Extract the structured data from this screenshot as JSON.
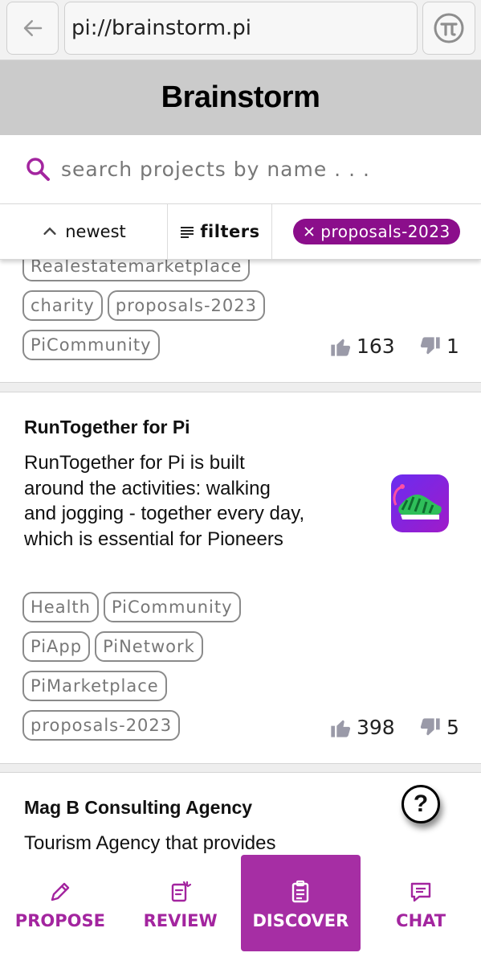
{
  "browser": {
    "url": "pi://brainstorm.pi",
    "back_icon": "arrow-left-icon",
    "pi_icon": "pi-logo-icon"
  },
  "header": {
    "title": "Brainstorm"
  },
  "search": {
    "placeholder": "search projects by name . . ."
  },
  "filters": {
    "sort_label": "newest",
    "filters_label": "filters",
    "active_filter": "proposals-2023"
  },
  "cards": [
    {
      "partial_tag": "Realestatemarketplace",
      "tags_row1": [
        "charity",
        "proposals-2023"
      ],
      "tags_row2": [
        "PiCommunity"
      ],
      "likes": "163",
      "dislikes": "1"
    },
    {
      "title": "RunTogether for Pi",
      "description": "RunTogether for Pi is built around the activities: walking and jogging - together every day, which is essential for Pioneers",
      "image_icon": "sneaker-app-icon",
      "tags": [
        [
          "Health",
          "PiCommunity"
        ],
        [
          "PiApp",
          "PiNetwork"
        ],
        [
          "PiMarketplace"
        ],
        [
          "proposals-2023"
        ]
      ],
      "likes": "398",
      "dislikes": "5"
    },
    {
      "title": "Mag B Consulting Agency",
      "description": "Tourism Agency that provides"
    }
  ],
  "help": {
    "label": "?"
  },
  "bottom_nav": {
    "items": [
      {
        "label": "PROPOSE",
        "icon": "pencil-icon"
      },
      {
        "label": "REVIEW",
        "icon": "review-icon"
      },
      {
        "label": "DISCOVER",
        "icon": "clipboard-icon"
      },
      {
        "label": "CHAT",
        "icon": "chat-icon"
      }
    ],
    "active": "DISCOVER"
  },
  "colors": {
    "accent": "#a62ea4",
    "chip": "#8b0e8b",
    "header_bg": "#cbcbcb",
    "vote_icon": "#9a9aa8"
  }
}
